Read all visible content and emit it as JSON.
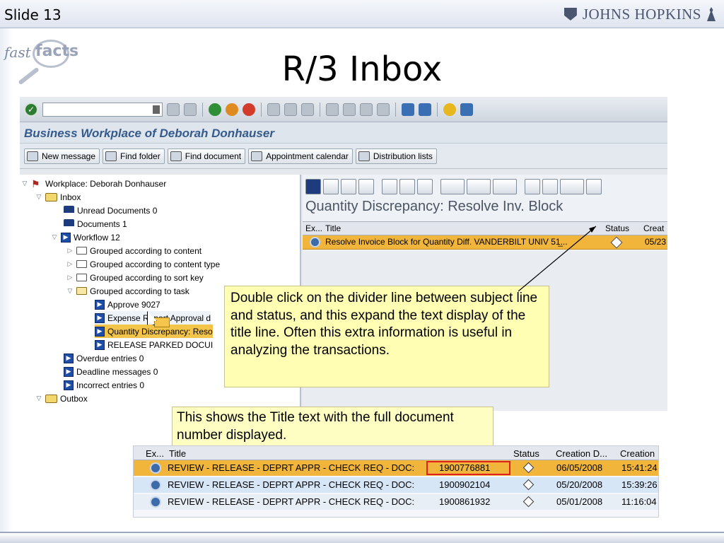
{
  "slide": {
    "label": "Slide 13",
    "brand": "JOHNS HOPKINS",
    "logo_fast": "fast",
    "logo_facts": "facts",
    "title": "R/3 Inbox"
  },
  "sap": {
    "workplace_title": "Business Workplace of Deborah Donhauser",
    "app_buttons": [
      "New message",
      "Find folder",
      "Find document",
      "Appointment calendar",
      "Distribution lists"
    ],
    "tree": [
      {
        "label": "Workplace: Deborah Donhauser"
      },
      {
        "label": "Inbox"
      },
      {
        "label": "Unread Documents 0"
      },
      {
        "label": "Documents 1"
      },
      {
        "label": "Workflow 12"
      },
      {
        "label": "Grouped according to content"
      },
      {
        "label": "Grouped according to content type"
      },
      {
        "label": "Grouped according to sort key"
      },
      {
        "label": "Grouped according to task"
      },
      {
        "label": "Approve 9027"
      },
      {
        "label": "Expense Report Approval d"
      },
      {
        "label": "Quantity Discrepancy: Reso"
      },
      {
        "label": "RELEASE PARKED DOCUI"
      },
      {
        "label": "Overdue entries 0"
      },
      {
        "label": "Deadline messages 0"
      },
      {
        "label": "Incorrect entries 0"
      },
      {
        "label": "Outbox"
      }
    ],
    "panel_heading": "Quantity Discrepancy: Resolve Inv. Block",
    "table_headers": {
      "ex": "Ex...",
      "title": "Title",
      "status": "Status",
      "created": "Creat"
    },
    "table_row": {
      "title": "Resolve Invoice Block for Quantity Diff. VANDERBILT UNIV 51̲...",
      "date": "05/23"
    }
  },
  "callouts": {
    "divider_note": "Double click on the divider line between subject line and status, and this expand the text display of the title line. Often this extra information is useful in analyzing the transactions.",
    "title_note": "This shows the Title text with the full document number displayed."
  },
  "zoom_table": {
    "headers": {
      "ex": "Ex...",
      "title": "Title",
      "status": "Status",
      "created_date": "Creation D...",
      "created_time": "Creation"
    },
    "rows": [
      {
        "title": "REVIEW - RELEASE - DEPRT APPR - CHECK REQ - DOC:",
        "doc": "1900776881",
        "date": "06/05/2008",
        "time": "15:41:24"
      },
      {
        "title": "REVIEW - RELEASE - DEPRT APPR - CHECK REQ - DOC:",
        "doc": "1900902104",
        "date": "05/20/2008",
        "time": "15:39:26"
      },
      {
        "title": "REVIEW - RELEASE - DEPRT APPR - CHECK REQ - DOC:",
        "doc": "1900861932",
        "date": "05/01/2008",
        "time": "11:16:04"
      }
    ]
  }
}
